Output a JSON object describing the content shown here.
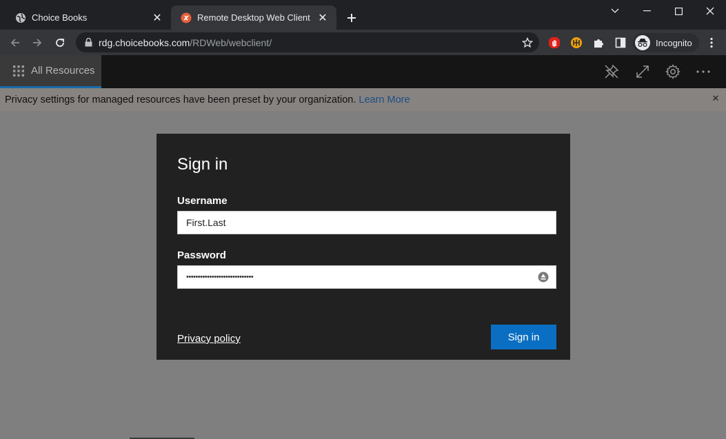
{
  "browser": {
    "tabs": [
      {
        "title": "Choice Books",
        "icon": "globe-icon",
        "active": false
      },
      {
        "title": "Remote Desktop Web Client",
        "icon": "remote-desktop-icon",
        "active": true
      }
    ],
    "url_host": "rdg.choicebooks.com",
    "url_path": "/RDWeb/webclient/",
    "profile_label": "Incognito"
  },
  "rd_client": {
    "nav_label": "All Resources",
    "toolbar_icons": [
      "pin-icon",
      "fullscreen-icon",
      "settings-icon",
      "more-icon"
    ]
  },
  "banner": {
    "message": "Privacy settings for managed resources have been preset by your organization.",
    "link": "Learn More"
  },
  "signin": {
    "title": "Sign in",
    "username_label": "Username",
    "username_value": "First.Last",
    "password_label": "Password",
    "password_mask": "•••••••••••••••••••••••••••••",
    "privacy_link": "Privacy policy",
    "button_label": "Sign in"
  },
  "colors": {
    "accent": "#0a6fc2",
    "dialog_bg": "#212121",
    "overlay_bg": "#7f7f7f"
  }
}
